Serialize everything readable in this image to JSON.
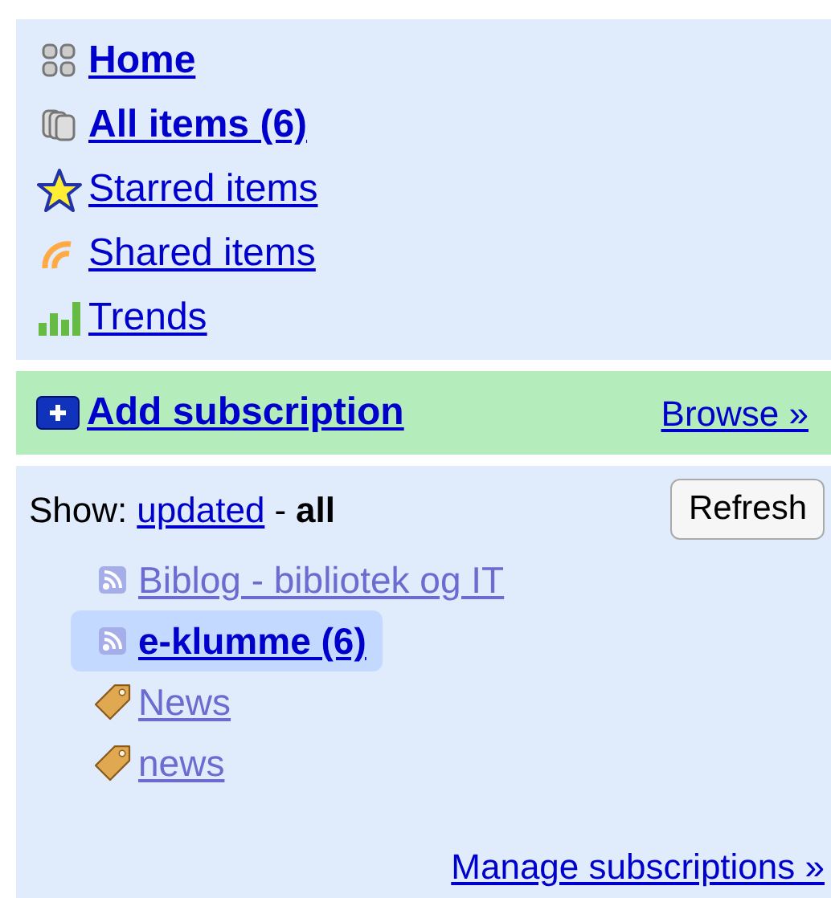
{
  "nav": [
    {
      "label": "Home",
      "kind": "home",
      "unread": true
    },
    {
      "label": "All items (6)",
      "kind": "all",
      "unread": true
    },
    {
      "label": "Starred items",
      "kind": "star",
      "unread": false
    },
    {
      "label": "Shared items",
      "kind": "shared",
      "unread": false
    },
    {
      "label": "Trends",
      "kind": "trends",
      "unread": false
    }
  ],
  "add_subscription": {
    "label": "Add subscription",
    "browse": "Browse »"
  },
  "show": {
    "label": "Show:",
    "separator": "-",
    "options": [
      {
        "label": "updated",
        "selected": false
      },
      {
        "label": "all",
        "selected": true
      }
    ]
  },
  "refresh": "Refresh",
  "subscriptions": [
    {
      "label": "Biblog - bibliotek og IT",
      "kind": "feed",
      "unread": false,
      "selected": false
    },
    {
      "label": "e-klumme (6)",
      "kind": "feed",
      "unread": true,
      "selected": true
    },
    {
      "label": "News",
      "kind": "tag",
      "unread": false,
      "selected": false
    },
    {
      "label": "news",
      "kind": "tag",
      "unread": false,
      "selected": false
    }
  ],
  "manage": "Manage subscriptions »"
}
